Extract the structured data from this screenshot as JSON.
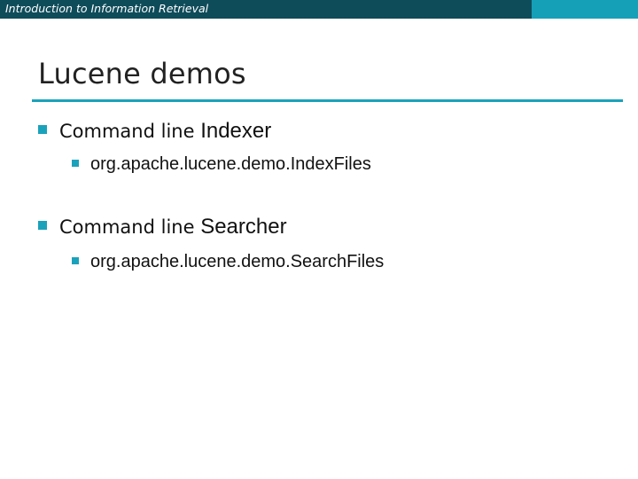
{
  "header": {
    "course_title": "Introduction to Information Retrieval"
  },
  "slide": {
    "title": "Lucene demos",
    "bullets": [
      {
        "prefix": "Command line ",
        "term": "Indexer",
        "sub": "org.apache.lucene.demo.IndexFiles"
      },
      {
        "prefix": "Command line ",
        "term": "Searcher",
        "sub": "org.apache.lucene.demo.SearchFiles"
      }
    ]
  },
  "colors": {
    "header_dark": "#0f4c5a",
    "header_accent": "#16a0b8",
    "rule_and_bullets": "#1aa2bb"
  },
  "icons": {
    "bullet_marker": "square-bullet-icon"
  }
}
